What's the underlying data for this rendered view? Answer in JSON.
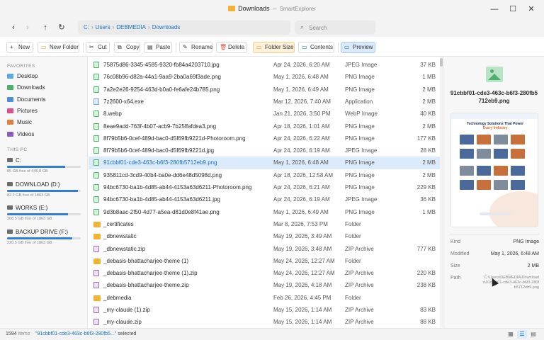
{
  "window": {
    "title": "Downloads",
    "separator": "–",
    "app_name": "SmartExplorer",
    "minimize": "—",
    "maximize": "☐",
    "close": "✕"
  },
  "nav": {
    "back": "‹",
    "forward": "›",
    "up": "↑",
    "refresh": "↻",
    "breadcrumb": [
      "C:",
      "Users",
      "DEBMEDIA",
      "Downloads"
    ],
    "crumb_sep": "›",
    "search_placeholder": "Search",
    "search_icon": "⌕"
  },
  "toolbar": {
    "new": "New",
    "new_folder": "New Folder",
    "cut": "Cut",
    "copy": "Copy",
    "paste": "Paste",
    "rename": "Rename",
    "delete": "Delete",
    "folder_size": "Folder Size",
    "contents": "Contents",
    "preview": "Preview",
    "icons": {
      "new": "+",
      "new_folder": "▭",
      "cut": "✂",
      "copy": "⧉",
      "paste": "▤",
      "rename": "✎",
      "delete": "🗑",
      "folder_size": "▭",
      "contents": "▭",
      "preview": "▭"
    }
  },
  "sidebar": {
    "favorites_header": "FAVORITES",
    "favorites": [
      {
        "label": "Desktop",
        "color": "#5aa9e6"
      },
      {
        "label": "Downloads",
        "color": "#4fb06b"
      },
      {
        "label": "Documents",
        "color": "#4a90d9"
      },
      {
        "label": "Pictures",
        "color": "#d94f8c"
      },
      {
        "label": "Music",
        "color": "#e0803a"
      },
      {
        "label": "Videos",
        "color": "#8a5cc0"
      }
    ],
    "thispc_header": "THIS PC",
    "drives": [
      {
        "name": "C:",
        "free": "95 GB free of 445.8 GB",
        "used_fraction": 0.79
      },
      {
        "name": "DOWNLOAD (D:)",
        "free": "82.2 GB free of 1863 GB",
        "used_fraction": 0.96
      },
      {
        "name": "WORKS (E:)",
        "free": "308.5 GB free of 1863 GB",
        "used_fraction": 0.83
      },
      {
        "name": "BACKUP DRIVE (F:)",
        "free": "220.5 GB free of 1863 GB",
        "used_fraction": 0.88
      }
    ]
  },
  "files": [
    {
      "name": "75875d86-3345-4585-9320-fb84a4203710.jpg",
      "date": "Apr 24, 2026, 6:20 AM",
      "type": "JPEG Image",
      "size": "37 KB",
      "kind": "img"
    },
    {
      "name": "76c08b96-d82a-44a1-9aa9-2ba0a69f3ade.png",
      "date": "May 1, 2026, 6:48 AM",
      "type": "PNG Image",
      "size": "1 MB",
      "kind": "img"
    },
    {
      "name": "7a2e2e26-9254-463d-b0a0-fe6afe24b785.png",
      "date": "May 1, 2026, 6:49 AM",
      "type": "PNG Image",
      "size": "2 MB",
      "kind": "img"
    },
    {
      "name": "7z2600-x64.exe",
      "date": "Mar 12, 2026, 7:40 AM",
      "type": "Application",
      "size": "2 MB",
      "kind": "app"
    },
    {
      "name": "8.webp",
      "date": "Jan 21, 2026, 3:50 PM",
      "type": "WebP Image",
      "size": "40 KB",
      "kind": "webp"
    },
    {
      "name": "8eae9add-763f-4b07-acb9-7b25ffafdea3.png",
      "date": "Apr 18, 2026, 1:01 AM",
      "type": "PNG Image",
      "size": "2 MB",
      "kind": "img"
    },
    {
      "name": "8f79b5b6-0cef-489d-bac0-d5f69fb9221d-Photoroom.png",
      "date": "Apr 24, 2026, 6:22 AM",
      "type": "PNG Image",
      "size": "177 KB",
      "kind": "img"
    },
    {
      "name": "8f79b5b6-0cef-489d-bac0-d5f69fb9221d.jpg",
      "date": "Apr 24, 2026, 6:19 AM",
      "type": "JPEG Image",
      "size": "28 KB",
      "kind": "img"
    },
    {
      "name": "91cbbf01-cde3-463c-b6f3-280fb5712eb9.png",
      "date": "May 1, 2026, 6:48 AM",
      "type": "PNG Image",
      "size": "2 MB",
      "kind": "img",
      "selected": true
    },
    {
      "name": "935811cd-3cd9-40b4-ba0e-dd6e48d5098d.png",
      "date": "Apr 18, 2026, 12:58 AM",
      "type": "PNG Image",
      "size": "2 MB",
      "kind": "img"
    },
    {
      "name": "94bc6730-ba1b-4d85-ab44-4153a63d6211-Photoroom.png",
      "date": "Apr 24, 2026, 6:21 AM",
      "type": "PNG Image",
      "size": "229 KB",
      "kind": "img"
    },
    {
      "name": "94bc6730-ba1b-4d85-ab44-4153a63d6211.jpg",
      "date": "Apr 24, 2026, 6:19 AM",
      "type": "JPEG Image",
      "size": "36 KB",
      "kind": "img"
    },
    {
      "name": "9d3b8aac-2f50-4d77-a5ea-d81d0e8f41ae.png",
      "date": "May 1, 2026, 6:49 AM",
      "type": "PNG Image",
      "size": "1 MB",
      "kind": "img"
    },
    {
      "name": "_certificates",
      "date": "Mar 8, 2026, 7:53 PM",
      "type": "Folder",
      "size": "",
      "kind": "folder"
    },
    {
      "name": "_dbnewstatic",
      "date": "May 19, 2026, 3:49 AM",
      "type": "Folder",
      "size": "",
      "kind": "folder"
    },
    {
      "name": "_dbnewstatic.zip",
      "date": "May 19, 2026, 3:48 AM",
      "type": "ZIP Archive",
      "size": "777 KB",
      "kind": "zip"
    },
    {
      "name": "_debasis-bhattacharjee-theme (1)",
      "date": "May 24, 2026, 12:27 AM",
      "type": "Folder",
      "size": "",
      "kind": "folder"
    },
    {
      "name": "_debasis-bhattacharjee-theme (1).zip",
      "date": "May 24, 2026, 12:27 AM",
      "type": "ZIP Archive",
      "size": "220 KB",
      "kind": "zip"
    },
    {
      "name": "_debasis-bhattacharjee-theme.zip",
      "date": "May 19, 2026, 4:18 AM",
      "type": "ZIP Archive",
      "size": "238 KB",
      "kind": "zip"
    },
    {
      "name": "_debmedia",
      "date": "Feb 26, 2026, 4:45 PM",
      "type": "Folder",
      "size": "",
      "kind": "folder"
    },
    {
      "name": "_my-claude (1).zip",
      "date": "May 15, 2026, 1:14 AM",
      "type": "ZIP Archive",
      "size": "83 KB",
      "kind": "zip"
    },
    {
      "name": "_my-claude.zip",
      "date": "May 15, 2026, 1:14 AM",
      "type": "ZIP Archive",
      "size": "88 KB",
      "kind": "zip"
    }
  ],
  "preview": {
    "filename": "91cbbf01-cde3-463c-b6f3-280fb5712eb9.png",
    "thumb_heading": "Technology Solutions That Power",
    "thumb_heading_hl": "Every Industry",
    "kind_label": "Kind",
    "kind_value": "PNG Image",
    "modified_label": "Modified",
    "modified_value": "May 1, 2026, 6:48 AM",
    "size_label": "Size",
    "size_value": "2 MB",
    "path_label": "Path",
    "path_value": "C:\\Users\\DEBMEDIA\\Downloads\\91cbbf01-cde3-463c-b6f3-280fb5712eb9.png"
  },
  "status": {
    "count": "1594",
    "count_label": "items",
    "selected_name": "\"91cbbf01-cde3-463c-b6f3-280fb5...\"",
    "selected_label": "selected",
    "view_icons": [
      "▦",
      "☰",
      "▤"
    ]
  },
  "colors": {
    "accent": "#1a6fc6",
    "selected_row": "#dcebfb",
    "folder": "#f2b233"
  }
}
